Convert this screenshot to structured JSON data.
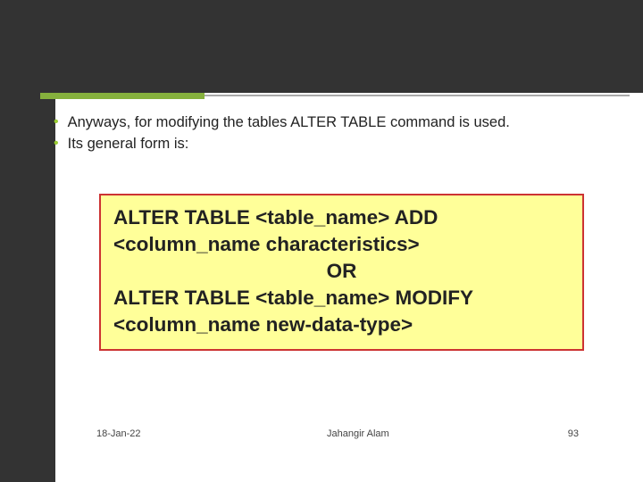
{
  "bullets": [
    "Anyways, for modifying the tables ALTER TABLE command is used.",
    "Its general form is:"
  ],
  "code": {
    "line1": "ALTER TABLE <table_name> ADD <column_name characteristics>",
    "or": "OR",
    "line2": "ALTER TABLE <table_name> MODIFY  <column_name new-data-type>"
  },
  "footer": {
    "date": "18-Jan-22",
    "author": "Jahangir Alam",
    "page": "93"
  }
}
